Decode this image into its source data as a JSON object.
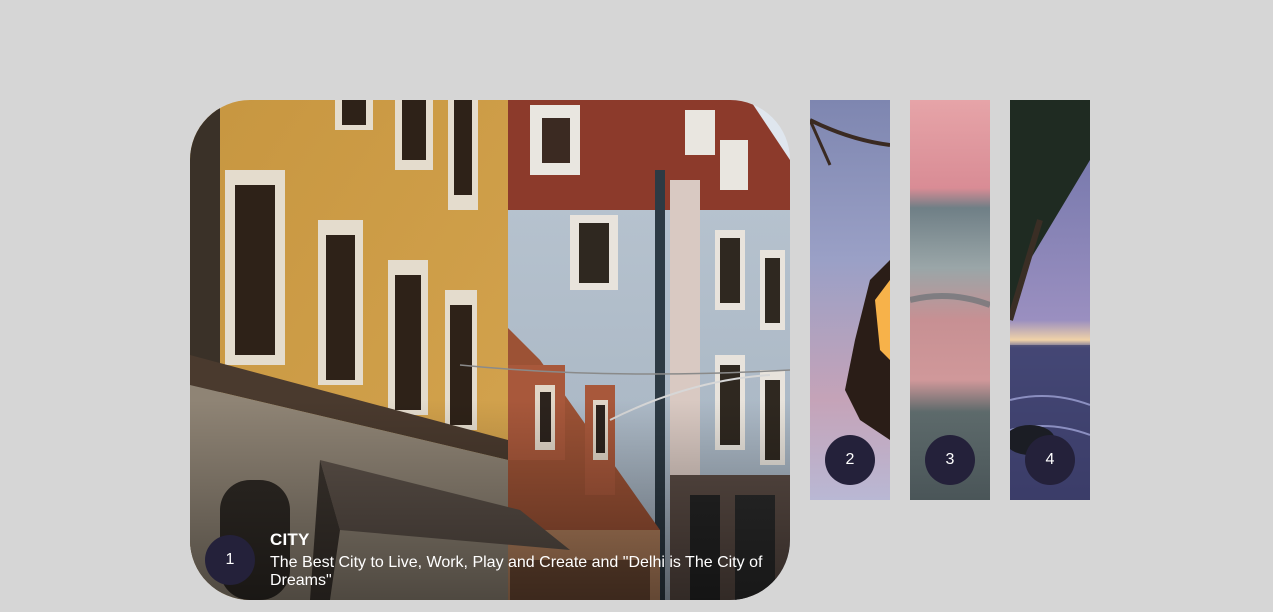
{
  "slides": [
    {
      "number": "1",
      "title": "CITY",
      "description": "The Best City to Live, Work, Play and Create and \"Delhi is The City of Dreams\"",
      "image": "city-street-buildings"
    },
    {
      "number": "2",
      "image": "campfire-flames"
    },
    {
      "number": "3",
      "image": "pink-sky-ocean"
    },
    {
      "number": "4",
      "image": "tree-beach-sunset"
    }
  ],
  "active_slide": "1",
  "colors": {
    "background": "#d6d6d6",
    "badge": "#24213a",
    "badge_text": "#ffffff"
  }
}
